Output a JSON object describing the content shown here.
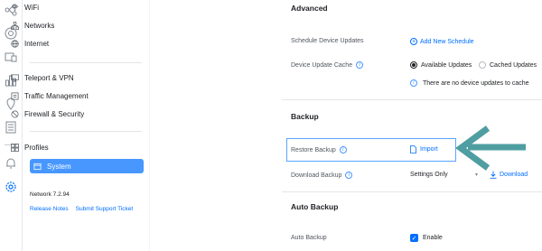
{
  "nav": {
    "items": [
      {
        "label": "WiFi",
        "icon": "wifi-icon"
      },
      {
        "label": "Networks",
        "icon": "networks-icon"
      },
      {
        "label": "Internet",
        "icon": "globe-icon"
      },
      {
        "label": "Teleport & VPN",
        "icon": "vpn-icon"
      },
      {
        "label": "Traffic Management",
        "icon": "traffic-icon"
      },
      {
        "label": "Firewall & Security",
        "icon": "shield-icon"
      },
      {
        "label": "Profiles",
        "icon": "profiles-icon"
      },
      {
        "label": "System",
        "icon": "system-icon"
      }
    ],
    "version": "Network 7.2.94",
    "release_notes": "Release Notes",
    "support_ticket": "Submit Support Ticket"
  },
  "advanced": {
    "title": "Advanced",
    "schedule_label": "Schedule Device Updates",
    "add_schedule": "Add New Schedule",
    "cache_label": "Device Update Cache",
    "option_available": "Available Updates",
    "option_cached": "Cached Updates",
    "cache_note": "There are no device updates to cache"
  },
  "backup": {
    "title": "Backup",
    "restore_label": "Restore Backup",
    "import": "Import",
    "download_label": "Download Backup",
    "select_value": "Settings Only",
    "download": "Download"
  },
  "auto_backup": {
    "title": "Auto Backup",
    "label": "Auto Backup",
    "enable": "Enable",
    "enabled": true
  },
  "colors": {
    "accent": "#006fff",
    "active_nav": "#4797ff",
    "arrow": "#4f9ea1"
  }
}
